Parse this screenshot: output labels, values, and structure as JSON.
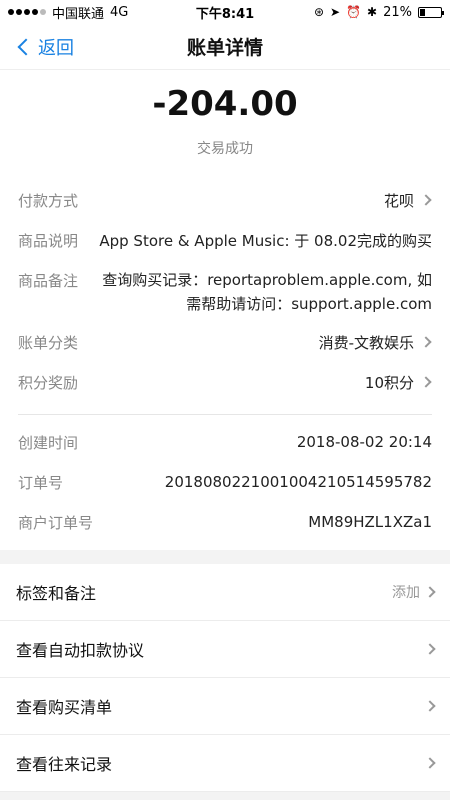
{
  "status_bar": {
    "carrier": "中国联通",
    "network": "4G",
    "time": "下午8:41",
    "battery_pct": "21%",
    "battery_level": 0.21,
    "icons": [
      "orientation-lock-icon",
      "location-icon",
      "alarm-icon",
      "bluetooth-icon"
    ]
  },
  "nav": {
    "back_label": "返回",
    "title": "账单详情"
  },
  "summary": {
    "amount": "-204.00",
    "status": "交易成功"
  },
  "details": [
    {
      "label": "付款方式",
      "value": "花呗",
      "chevron": true
    },
    {
      "label": "商品说明",
      "value": "App Store & Apple Music: 于 08.02完成的购买",
      "chevron": false
    },
    {
      "label": "商品备注",
      "value_line1": "查询购买记录：reportaproblem.apple.com, 如",
      "value_line2": "需帮助请访问：support.apple.com",
      "chevron": false
    },
    {
      "label": "账单分类",
      "value": "消费-文教娱乐",
      "chevron": true
    },
    {
      "label": "积分奖励",
      "value": "10积分",
      "chevron": true
    }
  ],
  "meta": [
    {
      "label": "创建时间",
      "value": "2018-08-02 20:14"
    },
    {
      "label": "订单号",
      "value": "20180802210010042105145957​82"
    },
    {
      "label": "商户订单号",
      "value": "MM89HZL1XZa1"
    }
  ],
  "menu": [
    {
      "label": "标签和备注",
      "action": "添加"
    },
    {
      "label": "查看自动扣款协议",
      "action": ""
    },
    {
      "label": "查看购买清单",
      "action": ""
    },
    {
      "label": "查看往来记录",
      "action": ""
    }
  ],
  "colors": {
    "accent": "#1a82e2",
    "background_gap": "#f3f3f3"
  }
}
